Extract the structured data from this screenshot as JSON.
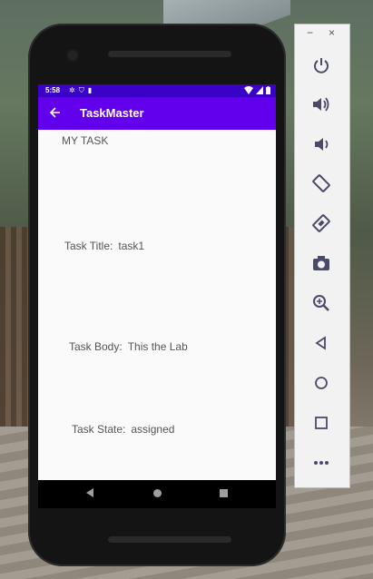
{
  "status_bar": {
    "time": "5:58"
  },
  "app_bar": {
    "title": "TaskMaster"
  },
  "content": {
    "heading": "MY TASK",
    "fields": [
      {
        "label": "Task Title:",
        "value": "task1"
      },
      {
        "label": "Task Body:",
        "value": "This the Lab"
      },
      {
        "label": "Task State:",
        "value": "assigned"
      }
    ]
  },
  "emulator_panel": {
    "minimize": "−",
    "close": "×",
    "tools": [
      "power-icon",
      "volume-up-icon",
      "volume-down-icon",
      "rotate-left-icon",
      "rotate-right-icon",
      "camera-icon",
      "zoom-icon",
      "back-icon",
      "home-icon",
      "overview-icon",
      "more-icon"
    ]
  },
  "colors": {
    "status_bar": "#3a02c7",
    "app_bar": "#6200ee",
    "content_bg": "#fafafa",
    "panel_icon": "#4a4a6a"
  }
}
